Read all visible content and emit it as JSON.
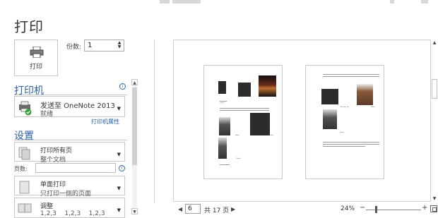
{
  "title": "打印",
  "print_button": {
    "label": "打印",
    "icon": "printer-icon"
  },
  "copies": {
    "label": "份数:",
    "value": "1"
  },
  "printer_section": {
    "heading": "打印机",
    "selected": {
      "name": "发送至 OneNote 2013",
      "status": "就绪",
      "icon": "onenote-printer-icon"
    },
    "properties_link": "打印机属性"
  },
  "settings_section": {
    "heading": "设置",
    "print_range": {
      "main": "打印所有页",
      "sub": "整个文档",
      "icon": "pages-icon"
    },
    "pages": {
      "label": "页数:",
      "value": ""
    },
    "sides": {
      "main": "单面打印",
      "sub": "只打印一侧的页面",
      "icon": "single-side-icon"
    },
    "collate": {
      "main": "调整",
      "sub": "1,2,3    1,2,3    1,2,3",
      "icon": "collate-icon"
    }
  },
  "preview": {
    "page_labels": {
      "p1_a": "Lorem",
      "p1_b": "Name",
      "p1_c": "Lorem",
      "p1_d": "Name",
      "p2_a": "Christian Tay",
      "p2_b": "Name",
      "p2_c": "Name"
    }
  },
  "footer": {
    "current_page": "6",
    "total_pages": "共 17 页",
    "zoom": "24%",
    "zoom_minus": "−",
    "zoom_plus": "+"
  },
  "colors": {
    "accent": "#2b62a7",
    "green_check": "#3aa03a"
  }
}
